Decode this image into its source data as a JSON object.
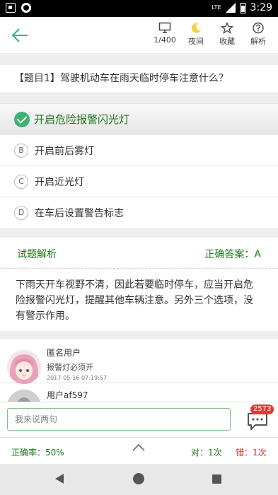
{
  "status_bar": {
    "network": "LTE",
    "time": "3:29"
  },
  "toolbar": {
    "tools": [
      {
        "icon": "monitor-icon",
        "label": "1/400"
      },
      {
        "icon": "moon-icon",
        "label": "夜间"
      },
      {
        "icon": "star-icon",
        "label": "收藏"
      },
      {
        "icon": "question-circle-icon",
        "label": "解析"
      }
    ]
  },
  "question": {
    "text": "【题目1】驾驶机动车在雨天临时停车注意什么？"
  },
  "options": [
    {
      "mark": "A",
      "text": "开启危险报警闪光灯",
      "correct": true
    },
    {
      "mark": "B",
      "text": "开启前后雾灯",
      "correct": false
    },
    {
      "mark": "C",
      "text": "开启近光灯",
      "correct": false
    },
    {
      "mark": "D",
      "text": "在车后设置警告标志",
      "correct": false
    }
  ],
  "analysis": {
    "title": "试题解析",
    "answer_label": "正确答案：A",
    "body": "下雨天开车视野不清，因此若要临时停车，应当开启危险报警闪光灯，提醒其他车辆注意。另外三个选项，没有警示作用。"
  },
  "comments": [
    {
      "user": "匿名用户",
      "text": "报警灯必须开",
      "time": "2017-05-16 07:19:57"
    },
    {
      "user": "用户af597",
      "text": "",
      "time": ""
    }
  ],
  "input": {
    "placeholder": "我来说两句"
  },
  "comment_count": "2573",
  "stats": {
    "accuracy": "正确率：50%",
    "right": "对：1次",
    "wrong": "错：1次"
  },
  "colors": {
    "accent": "#1a7a1a",
    "error": "#d32f2f",
    "badge": "#e53935"
  }
}
